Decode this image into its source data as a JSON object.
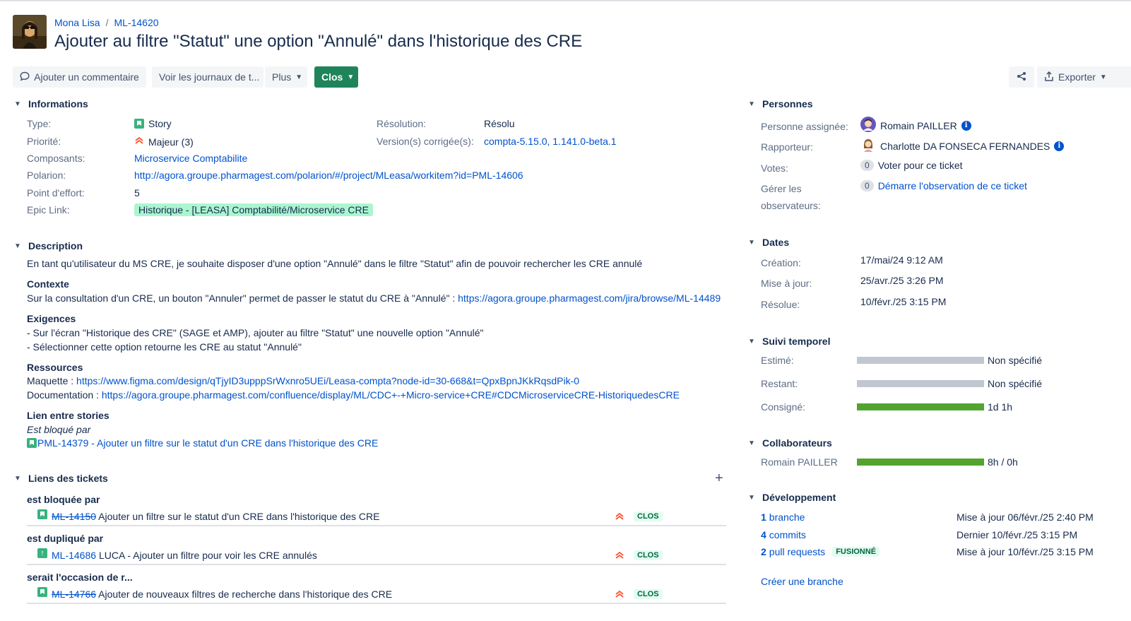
{
  "breadcrumb": {
    "project": "Mona Lisa",
    "key": "ML-14620"
  },
  "title": "Ajouter au filtre \"Statut\" une option \"Annulé\" dans l'historique des CRE",
  "toolbar": {
    "comment": "Ajouter un commentaire",
    "worklogs": "Voir les journaux de t...",
    "more": "Plus",
    "status": "Clos",
    "export": "Exporter"
  },
  "informations": {
    "header": "Informations",
    "type_label": "Type:",
    "type_value": "Story",
    "priority_label": "Priorité:",
    "priority_value": "Majeur (3)",
    "components_label": "Composants:",
    "components_value": "Microservice Comptabilite",
    "polarion_label": "Polarion:",
    "polarion_value": "http://agora.groupe.pharmagest.com/polarion/#/project/MLeasa/workitem?id=PML-14606",
    "effort_label": "Point d'effort:",
    "effort_value": "5",
    "epic_label": "Epic Link:",
    "epic_value": "Historique - [LEASA] Comptabilité/Microservice CRE",
    "resolution_label": "Résolution:",
    "resolution_value": "Résolu",
    "fixversion_label": "Version(s) corrigée(s):",
    "fixversion_value": "compta-5.15.0, 1.141.0-beta.1"
  },
  "description": {
    "header": "Description",
    "intro": "En tant qu'utilisateur du MS CRE, je souhaite disposer d'une option \"Annulé\" dans le filtre \"Statut\" afin de pouvoir rechercher les CRE annulé",
    "context_title": "Contexte",
    "context_text": "Sur la consultation d'un CRE, un bouton \"Annuler\" permet de passer le statut du CRE à \"Annulé\" : ",
    "context_link": "https://agora.groupe.pharmagest.com/jira/browse/ML-14489",
    "req_title": "Exigences",
    "req_1": "- Sur l'écran \"Historique des CRE\" (SAGE et AMP), ajouter au filtre \"Statut\" une nouvelle option \"Annulé\"",
    "req_2": "- Sélectionner cette option retourne les CRE au statut \"Annulé\"",
    "res_title": "Ressources",
    "res_mock_label": "Maquette : ",
    "res_mock_link": "https://www.figma.com/design/qTjyID3upppSrWxnro5UEi/Leasa-compta?node-id=30-668&t=QpxBpnJKkRqsdPik-0",
    "res_doc_label": "Documentation : ",
    "res_doc_link": "https://agora.groupe.pharmagest.com/confluence/display/ML/CDC+-+Micro-service+CRE#CDCMicroserviceCRE-HistoriquedesCRE",
    "stories_title": "Lien entre stories",
    "stories_blocked": "Est bloqué par",
    "stories_link": "PML-14379 - Ajouter un filtre sur le statut d'un CRE dans l'historique des CRE"
  },
  "issue_links": {
    "header": "Liens des tickets",
    "add": "+",
    "groups": [
      {
        "title": "est bloquée par",
        "key": "ML-14150",
        "summary": "Ajouter un filtre sur le statut d'un CRE dans l'historique des CRE",
        "status": "CLOS"
      },
      {
        "title": "est dupliqué par",
        "key": "ML-14686",
        "summary": "LUCA - Ajouter un filtre pour voir les CRE annulés",
        "status": "CLOS"
      },
      {
        "title": "serait l'occasion de r...",
        "key": "ML-14766",
        "summary": "Ajouter de nouveaux filtres de recherche dans l'historique des CRE",
        "status": "CLOS"
      }
    ]
  },
  "people": {
    "header": "Personnes",
    "assignee_label": "Personne assignée:",
    "assignee": "Romain PAILLER",
    "reporter_label": "Rapporteur:",
    "reporter": "Charlotte DA FONSECA FERNANDES",
    "votes_label": "Votes:",
    "votes_count": "0",
    "votes_action": "Voter pour ce ticket",
    "watchers_label_1": "Gérer les",
    "watchers_label_2": "observateurs:",
    "watchers_count": "0",
    "watchers_action": "Démarre l'observation de ce ticket"
  },
  "dates": {
    "header": "Dates",
    "created_label": "Création:",
    "created": "17/mai/24 9:12 AM",
    "updated_label": "Mise à jour:",
    "updated": "25/avr./25 3:26 PM",
    "resolved_label": "Résolue:",
    "resolved": "10/févr./25 3:15 PM"
  },
  "time_tracking": {
    "header": "Suivi temporel",
    "estimated_label": "Estimé:",
    "estimated": "Non spécifié",
    "estimated_fill": 0,
    "remaining_label": "Restant:",
    "remaining": "Non spécifié",
    "remaining_fill": 0,
    "logged_label": "Consigné:",
    "logged": "1d 1h",
    "logged_fill": 1
  },
  "collaborators": {
    "header": "Collaborateurs",
    "name": "Romain PAILLER",
    "value": "8h / 0h",
    "fill": 1
  },
  "development": {
    "header": "Développement",
    "branch_count": "1",
    "branch_label": "branche",
    "branch_date": "Mise à jour 06/févr./25 2:40 PM",
    "commit_count": "4",
    "commit_label": "commits",
    "commit_date": "Dernier 10/févr./25 3:15 PM",
    "pr_count": "2",
    "pr_label": "pull requests",
    "pr_badge": "FUSIONNÉ",
    "pr_date": "Mise à jour 10/févr./25 3:15 PM",
    "create_branch": "Créer une branche"
  },
  "colors": {
    "accent": "#0052cc",
    "status_green": "#1f845a",
    "bar_green": "#52a42f",
    "bar_grey": "#c1c7d0"
  }
}
